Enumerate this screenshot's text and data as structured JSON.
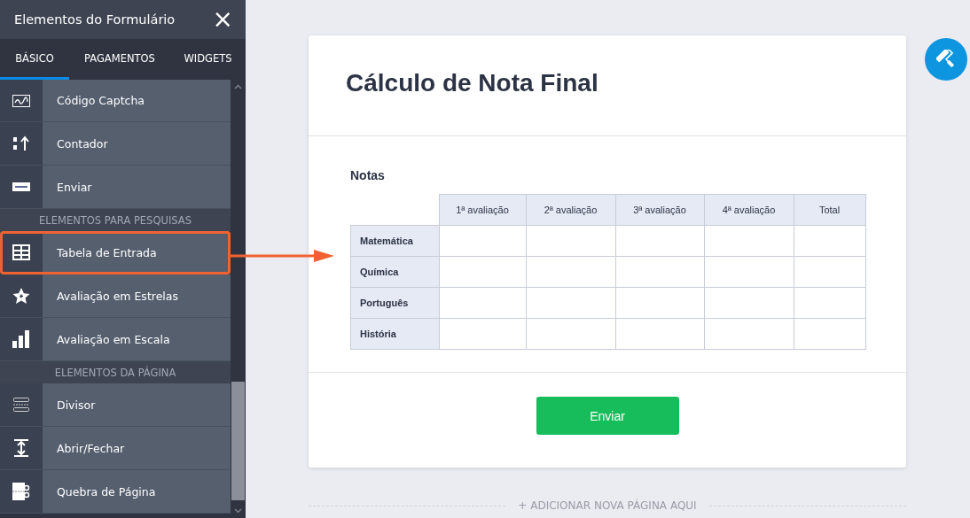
{
  "sidebar": {
    "title": "Elementos do Formulário",
    "close": "×",
    "tabs": [
      {
        "label": "BÁSICO",
        "selected": true
      },
      {
        "label": "PAGAMENTOS",
        "selected": false
      },
      {
        "label": "WIDGETS",
        "selected": false
      }
    ],
    "items": [
      {
        "kind": "captcha",
        "label": "Código Captcha",
        "highlighted": false
      },
      {
        "kind": "counter",
        "label": "Contador",
        "highlighted": false
      },
      {
        "kind": "send",
        "label": "Enviar",
        "highlighted": false
      },
      {
        "kind": "section",
        "label": "ELEMENTOS PARA PESQUISAS"
      },
      {
        "kind": "table",
        "label": "Tabela de Entrada",
        "highlighted": true
      },
      {
        "kind": "star",
        "label": "Avaliação em Estrelas",
        "highlighted": false
      },
      {
        "kind": "scale",
        "label": "Avaliação em Escala",
        "highlighted": false
      },
      {
        "kind": "section",
        "label": "ELEMENTOS DA PÁGINA"
      },
      {
        "kind": "divider",
        "label": "Divisor",
        "highlighted": false
      },
      {
        "kind": "collapse",
        "label": "Abrir/Fechar",
        "highlighted": false
      },
      {
        "kind": "pagebreak",
        "label": "Quebra de Página",
        "highlighted": false
      }
    ]
  },
  "form": {
    "title": "Cálculo de Nota Final",
    "table": {
      "label": "Notas",
      "columns": [
        "1ª avaliação",
        "2ª avaliação",
        "3ª avaliação",
        "4ª avaliação",
        "Total"
      ],
      "rows": [
        "Matemática",
        "Química",
        "Português",
        "História"
      ]
    },
    "submit": "Enviar"
  },
  "add_page": "+ ADICIONAR NOVA PÁGINA AQUI"
}
